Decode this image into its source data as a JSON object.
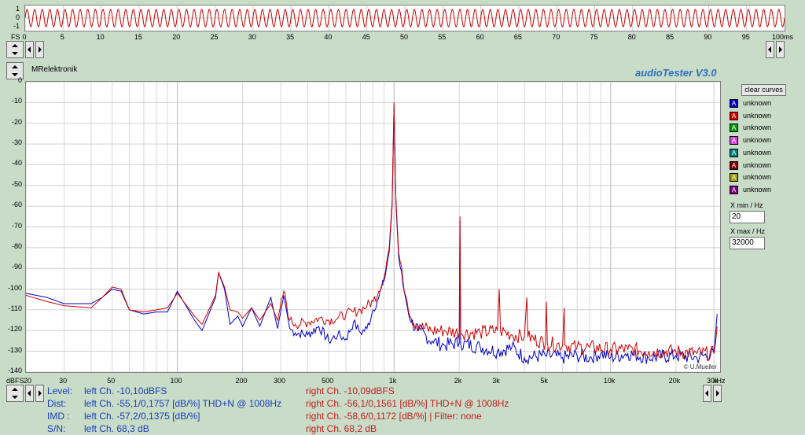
{
  "app": {
    "title": "audioTester  V3.0",
    "author_label": "MRelektronik",
    "copyright": "© U.Mueller"
  },
  "time_axis": {
    "left_label": "FS",
    "ticks": [
      "0",
      "5",
      "10",
      "15",
      "20",
      "25",
      "30",
      "35",
      "40",
      "45",
      "50",
      "55",
      "60",
      "65",
      "70",
      "75",
      "80",
      "85",
      "90",
      "95"
    ],
    "unit_label": "100ms",
    "y_labels": [
      "1",
      "0",
      "-1"
    ]
  },
  "sidebar": {
    "clear_label": "clear curves",
    "items": [
      {
        "label": "unknown",
        "color": "#0000c8",
        "letter": "A"
      },
      {
        "label": "unknown",
        "color": "#e00000",
        "letter": "A"
      },
      {
        "label": "unknown",
        "color": "#00a000",
        "letter": "A"
      },
      {
        "label": "unknown",
        "color": "#e040e0",
        "letter": "A"
      },
      {
        "label": "unknown",
        "color": "#008080",
        "letter": "A"
      },
      {
        "label": "unknown",
        "color": "#800000",
        "letter": "A"
      },
      {
        "label": "unknown",
        "color": "#a0a000",
        "letter": "A"
      },
      {
        "label": "unknown",
        "color": "#800080",
        "letter": "A"
      }
    ],
    "xmin_label": "X min / Hz",
    "xmin_value": "20",
    "xmax_label": "X max / Hz",
    "xmax_value": "32000"
  },
  "status": {
    "rows": [
      {
        "label": "Level:",
        "left": "left Ch. -10,10dBFS",
        "right": "right Ch. -10,09dBFS"
      },
      {
        "label": "Dist:",
        "left": "left Ch. -55,1/0,1757 [dB/%] THD+N  @ 1008Hz",
        "right": "right Ch. -56,1/0,1561 [dB/%] THD+N  @ 1008Hz"
      },
      {
        "label": "IMD  :",
        "left": "left Ch. -57,2/0,1375 [dB/%]",
        "right": "right Ch. -58,6/0,1172 [dB/%] |   Filter: none"
      },
      {
        "label": "S/N:",
        "left": "left Ch. 68,3 dB",
        "right": "right Ch. 68,2 dB"
      }
    ]
  },
  "chart_data": {
    "type": "line",
    "xscale": "log",
    "xlim": [
      20,
      32000
    ],
    "ylim": [
      -140,
      0
    ],
    "ylabel": "dBFS",
    "xunit": "kHz",
    "grid": true,
    "x_tick_labels": [
      "20",
      "30",
      "50",
      "100",
      "200",
      "300",
      "500",
      "1k",
      "2k",
      "3k",
      "5k",
      "10k",
      "20k",
      "30k"
    ],
    "x_tick_values": [
      20,
      30,
      50,
      100,
      200,
      300,
      500,
      1000,
      2000,
      3000,
      5000,
      10000,
      20000,
      30000
    ],
    "y_tick_labels": [
      "0",
      "-10",
      "-20",
      "-30",
      "-40",
      "-50",
      "-60",
      "-70",
      "-80",
      "-90",
      "-100",
      "-110",
      "-120",
      "-130",
      "-140"
    ],
    "y_tick_values": [
      0,
      -10,
      -20,
      -30,
      -40,
      -50,
      -60,
      -70,
      -80,
      -90,
      -100,
      -110,
      -120,
      -130,
      -140
    ],
    "series": [
      {
        "color": "#0000c8",
        "points": [
          [
            20,
            -102
          ],
          [
            25,
            -104
          ],
          [
            30,
            -107
          ],
          [
            40,
            -107
          ],
          [
            45,
            -104
          ],
          [
            50,
            -100
          ],
          [
            55,
            -101
          ],
          [
            60,
            -110
          ],
          [
            70,
            -112
          ],
          [
            80,
            -111
          ],
          [
            90,
            -111
          ],
          [
            100,
            -101
          ],
          [
            120,
            -115
          ],
          [
            130,
            -120
          ],
          [
            150,
            -104
          ],
          [
            155,
            -92
          ],
          [
            165,
            -100
          ],
          [
            175,
            -117
          ],
          [
            190,
            -113
          ],
          [
            200,
            -118
          ],
          [
            220,
            -109
          ],
          [
            240,
            -118
          ],
          [
            270,
            -104
          ],
          [
            290,
            -119
          ],
          [
            310,
            -103
          ],
          [
            330,
            -119
          ],
          [
            350,
            -121
          ],
          [
            400,
            -122
          ],
          [
            450,
            -118
          ],
          [
            500,
            -125
          ],
          [
            550,
            -122
          ],
          [
            600,
            -124
          ],
          [
            650,
            -116
          ],
          [
            700,
            -121
          ],
          [
            750,
            -119
          ],
          [
            800,
            -110
          ],
          [
            850,
            -104
          ],
          [
            900,
            -96
          ],
          [
            950,
            -82
          ],
          [
            980,
            -60
          ],
          [
            1000,
            -12
          ],
          [
            1020,
            -58
          ],
          [
            1050,
            -84
          ],
          [
            1100,
            -98
          ],
          [
            1150,
            -108
          ],
          [
            1200,
            -116
          ],
          [
            1300,
            -120
          ],
          [
            1500,
            -125
          ],
          [
            1700,
            -127
          ],
          [
            2000,
            -126
          ],
          [
            2016,
            -67
          ],
          [
            2030,
            -126
          ],
          [
            2500,
            -128
          ],
          [
            3000,
            -130
          ],
          [
            3500,
            -128
          ],
          [
            4000,
            -133
          ],
          [
            5000,
            -132
          ],
          [
            6000,
            -133
          ],
          [
            7000,
            -132
          ],
          [
            8000,
            -133
          ],
          [
            9000,
            -131
          ],
          [
            10000,
            -133
          ],
          [
            12000,
            -131
          ],
          [
            15000,
            -133
          ],
          [
            20000,
            -132
          ],
          [
            25000,
            -133
          ],
          [
            30000,
            -131
          ],
          [
            31000,
            -112
          ]
        ]
      },
      {
        "color": "#d00000",
        "points": [
          [
            20,
            -103
          ],
          [
            25,
            -106
          ],
          [
            30,
            -108
          ],
          [
            40,
            -109
          ],
          [
            45,
            -104
          ],
          [
            50,
            -99
          ],
          [
            55,
            -100
          ],
          [
            60,
            -110
          ],
          [
            70,
            -111
          ],
          [
            80,
            -110
          ],
          [
            90,
            -109
          ],
          [
            100,
            -102
          ],
          [
            120,
            -113
          ],
          [
            130,
            -117
          ],
          [
            150,
            -103
          ],
          [
            155,
            -92
          ],
          [
            165,
            -99
          ],
          [
            175,
            -110
          ],
          [
            190,
            -111
          ],
          [
            200,
            -114
          ],
          [
            220,
            -109
          ],
          [
            240,
            -115
          ],
          [
            270,
            -107
          ],
          [
            290,
            -115
          ],
          [
            310,
            -101
          ],
          [
            330,
            -115
          ],
          [
            350,
            -117
          ],
          [
            400,
            -116
          ],
          [
            450,
            -114
          ],
          [
            500,
            -115
          ],
          [
            550,
            -114
          ],
          [
            600,
            -112
          ],
          [
            650,
            -111
          ],
          [
            700,
            -110
          ],
          [
            750,
            -108
          ],
          [
            800,
            -106
          ],
          [
            850,
            -101
          ],
          [
            900,
            -94
          ],
          [
            950,
            -80
          ],
          [
            980,
            -58
          ],
          [
            1000,
            -10
          ],
          [
            1020,
            -56
          ],
          [
            1050,
            -82
          ],
          [
            1100,
            -96
          ],
          [
            1150,
            -106
          ],
          [
            1200,
            -114
          ],
          [
            1300,
            -118
          ],
          [
            1500,
            -120
          ],
          [
            1700,
            -120
          ],
          [
            2000,
            -121
          ],
          [
            2016,
            -65
          ],
          [
            2030,
            -121
          ],
          [
            2500,
            -121
          ],
          [
            3000,
            -120
          ],
          [
            3060,
            -100
          ],
          [
            3100,
            -120
          ],
          [
            3500,
            -122
          ],
          [
            4000,
            -123
          ],
          [
            4100,
            -104
          ],
          [
            4150,
            -123
          ],
          [
            5000,
            -126
          ],
          [
            5050,
            -106
          ],
          [
            5100,
            -126
          ],
          [
            6000,
            -127
          ],
          [
            6100,
            -109
          ],
          [
            6150,
            -127
          ],
          [
            7000,
            -128
          ],
          [
            8000,
            -128
          ],
          [
            10000,
            -129
          ],
          [
            12000,
            -129
          ],
          [
            15000,
            -130
          ],
          [
            20000,
            -130
          ],
          [
            25000,
            -131
          ],
          [
            30000,
            -131
          ],
          [
            31000,
            -118
          ]
        ]
      }
    ]
  }
}
